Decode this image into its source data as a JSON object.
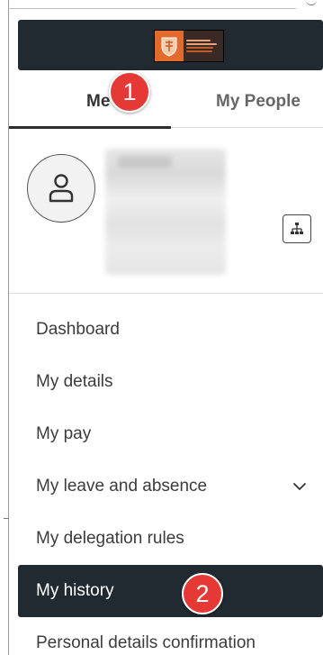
{
  "tabs": [
    {
      "label": "Me",
      "active": true
    },
    {
      "label": "My People",
      "active": false
    }
  ],
  "callouts": {
    "first": "1",
    "second": "2"
  },
  "menu": {
    "items": [
      {
        "label": "Dashboard"
      },
      {
        "label": "My details"
      },
      {
        "label": "My pay"
      },
      {
        "label": "My leave and absence",
        "expandable": true
      },
      {
        "label": "My delegation rules"
      },
      {
        "label": "My history",
        "active": true
      },
      {
        "label": "Personal details confirmation"
      }
    ]
  },
  "colors": {
    "header_bg": "#212a31",
    "callout_red": "#e53935",
    "logo_orange": "#e26a2c"
  },
  "icons": {
    "avatar": "user-icon",
    "org_chart": "org-chart-icon",
    "expand": "chevron-down-icon"
  }
}
